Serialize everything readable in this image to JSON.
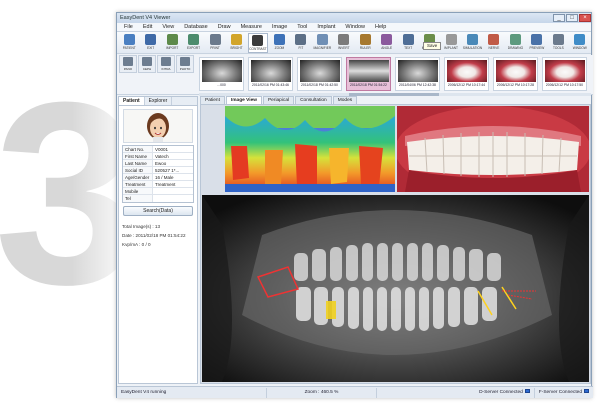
{
  "decor": {
    "big_number": "3"
  },
  "window": {
    "title": "EasyDent V4 Viewer",
    "controls": [
      "_",
      "□",
      "×"
    ]
  },
  "menu": [
    "File",
    "Edit",
    "View",
    "Database",
    "Draw",
    "Measure",
    "Image",
    "Tool",
    "Implant",
    "Window",
    "Help"
  ],
  "toolbar": {
    "buttons": [
      {
        "label": "PATIENT",
        "icon": "patient-icon",
        "color": "#4a7fc1"
      },
      {
        "label": "EXIT",
        "icon": "exit-icon",
        "color": "#3f6aa7"
      },
      {
        "label": "IMPORT",
        "icon": "import-icon",
        "color": "#5d8a4a"
      },
      {
        "label": "EXPORT",
        "icon": "export-icon",
        "color": "#4c8c6d"
      },
      {
        "label": "PRINT",
        "icon": "print-icon",
        "color": "#6b7a8c"
      },
      {
        "label": "BRIGHT",
        "icon": "brightness-icon",
        "color": "#d2a52a"
      },
      {
        "label": "CONTRAST",
        "icon": "contrast-icon",
        "color": "#3b3b3b"
      },
      {
        "label": "ZOOM",
        "icon": "zoom-icon",
        "color": "#3d72b8"
      },
      {
        "label": "FIT",
        "icon": "fit-icon",
        "color": "#5c6f86"
      },
      {
        "label": "MAGNIFIER",
        "icon": "magnifier-icon",
        "color": "#6f8fb5"
      },
      {
        "label": "INVERT",
        "icon": "invert-icon",
        "color": "#7b7b7b"
      },
      {
        "label": "RULER",
        "icon": "ruler-icon",
        "color": "#a6782e"
      },
      {
        "label": "ANGLE",
        "icon": "angle-icon",
        "color": "#8b5a9d"
      },
      {
        "label": "TEXT",
        "icon": "text-icon",
        "color": "#4f6e96"
      },
      {
        "label": "MEASURE",
        "icon": "measure-icon",
        "color": "#6b8e4a"
      },
      {
        "label": "IMPLANT",
        "icon": "implant-icon",
        "color": "#999999"
      },
      {
        "label": "SIMULATION",
        "icon": "simulation-icon",
        "color": "#4a89b8"
      },
      {
        "label": "NERVE",
        "icon": "nerve-icon",
        "color": "#c05a46"
      },
      {
        "label": "DRAWING",
        "icon": "drawing-icon",
        "color": "#5d9a7e"
      },
      {
        "label": "PREVIEW",
        "icon": "preview-icon",
        "color": "#4a72a8"
      },
      {
        "label": "TOOLS",
        "icon": "tools-icon",
        "color": "#6b7a8c"
      },
      {
        "label": "WINDOW",
        "icon": "window-icon",
        "color": "#3f8cc7"
      }
    ],
    "tooltip": "Save"
  },
  "toolbar2": [
    {
      "label": "PANO",
      "icon": "pano-icon"
    },
    {
      "label": "CEPH",
      "icon": "ceph-icon"
    },
    {
      "label": "INTRA",
      "icon": "intraoral-icon"
    },
    {
      "label": "PHOTO",
      "icon": "photo-icon"
    }
  ],
  "thumbnails": [
    {
      "caption": "...000",
      "kind": "xray"
    },
    {
      "caption": "2011/02/16 PM 01:43:46",
      "kind": "xray"
    },
    {
      "caption": "2011/02/18 PM 01:42:50",
      "kind": "xray"
    },
    {
      "caption": "2011/02/18 PM 01:54:22",
      "kind": "pano",
      "selected": true
    },
    {
      "caption": "2011/04/06 PM 12:42:38",
      "kind": "xray"
    },
    {
      "caption": "2006/12/12 PM 10:17:44",
      "kind": "photo"
    },
    {
      "caption": "2006/12/12 PM 10:17:28",
      "kind": "photo"
    },
    {
      "caption": "2006/12/12 PM 10:17:50",
      "kind": "photo"
    }
  ],
  "left_panel": {
    "tabs": [
      "Patient",
      "Explorer"
    ],
    "fields": [
      {
        "k": "Chart No.",
        "v": "V0001"
      },
      {
        "k": "First Name",
        "v": "Vatech"
      },
      {
        "k": "Last Name",
        "v": "Ewoo"
      },
      {
        "k": "Social ID",
        "v": "520527 1*..."
      },
      {
        "k": "Age/Gender",
        "v": "16 / Male"
      },
      {
        "k": "Treatment",
        "v": "Treatment"
      },
      {
        "k": "Mobile",
        "v": ""
      },
      {
        "k": "Tel",
        "v": ""
      }
    ],
    "search_button": "Search(Data)",
    "info": [
      "Total Image(s) : 13",
      "Date : 2011/02/18 PM 01:54:22",
      "Kvp/mA : 0 / 0"
    ]
  },
  "view_tabs": [
    "Patient",
    "Image View",
    "Periapical",
    "Consultation",
    "Modes"
  ],
  "view_tab_active": 1,
  "statusbar": {
    "left": "EasyDent V4 running",
    "zoom": "Zoom : 460.5 %",
    "dserver": "D-Server Connected",
    "fserver": "F-Server Connected"
  }
}
